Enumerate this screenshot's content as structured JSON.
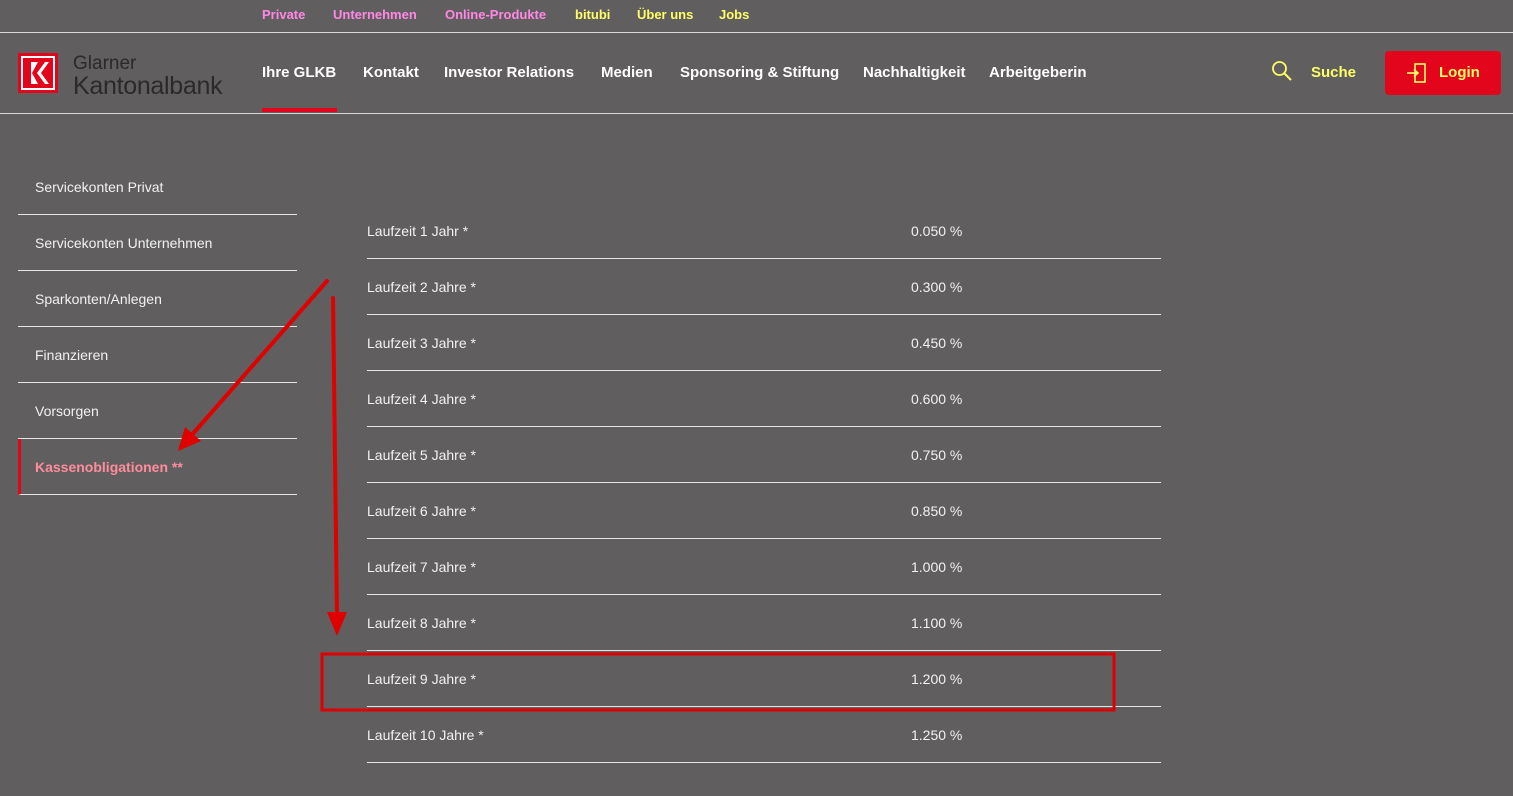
{
  "topbar": {
    "links": [
      "Private",
      "Unternehmen",
      "Online-Produkte",
      "bitubi",
      "Über uns",
      "Jobs"
    ]
  },
  "header": {
    "logo_line1": "Glarner",
    "logo_line2": "Kantonalbank",
    "nav": [
      "Ihre GLKB",
      "Kontakt",
      "Investor Relations",
      "Medien",
      "Sponsoring & Stiftung",
      "Nachhaltigkeit",
      "Arbeitgeberin"
    ],
    "active_nav": "Ihre GLKB",
    "search_label": "Suche",
    "login_label": "Login"
  },
  "sidebar": {
    "items": [
      {
        "label": "Servicekonten Privat"
      },
      {
        "label": "Servicekonten Unternehmen"
      },
      {
        "label": "Sparkonten/Anlegen"
      },
      {
        "label": "Finanzieren"
      },
      {
        "label": "Vorsorgen"
      },
      {
        "label": "Kassenobligationen **"
      }
    ],
    "active_index": 5
  },
  "rates": [
    {
      "label": "Laufzeit 1 Jahr *",
      "value": "0.050 %"
    },
    {
      "label": "Laufzeit 2 Jahre *",
      "value": "0.300 %"
    },
    {
      "label": "Laufzeit 3 Jahre *",
      "value": "0.450 %"
    },
    {
      "label": "Laufzeit 4 Jahre *",
      "value": "0.600 %"
    },
    {
      "label": "Laufzeit 5 Jahre *",
      "value": "0.750 %"
    },
    {
      "label": "Laufzeit 6 Jahre *",
      "value": "0.850 %"
    },
    {
      "label": "Laufzeit 7 Jahre *",
      "value": "1.000 %"
    },
    {
      "label": "Laufzeit 8 Jahre *",
      "value": "1.100 %"
    },
    {
      "label": "Laufzeit 9 Jahre *",
      "value": "1.200 %"
    },
    {
      "label": "Laufzeit 10 Jahre *",
      "value": "1.250 %"
    }
  ],
  "highlighted_rate_index": 8,
  "colors": {
    "background": "#605e5f",
    "brand_red": "#e3051b",
    "topbar_pink": "#ff88e6",
    "topbar_yellow": "#ffff66",
    "active_sidebar_text": "#ff8c9c",
    "annotation_red": "#e00000"
  },
  "icons": {
    "logo": "glkb-logo-icon",
    "search": "search-icon",
    "login": "login-door-icon"
  }
}
